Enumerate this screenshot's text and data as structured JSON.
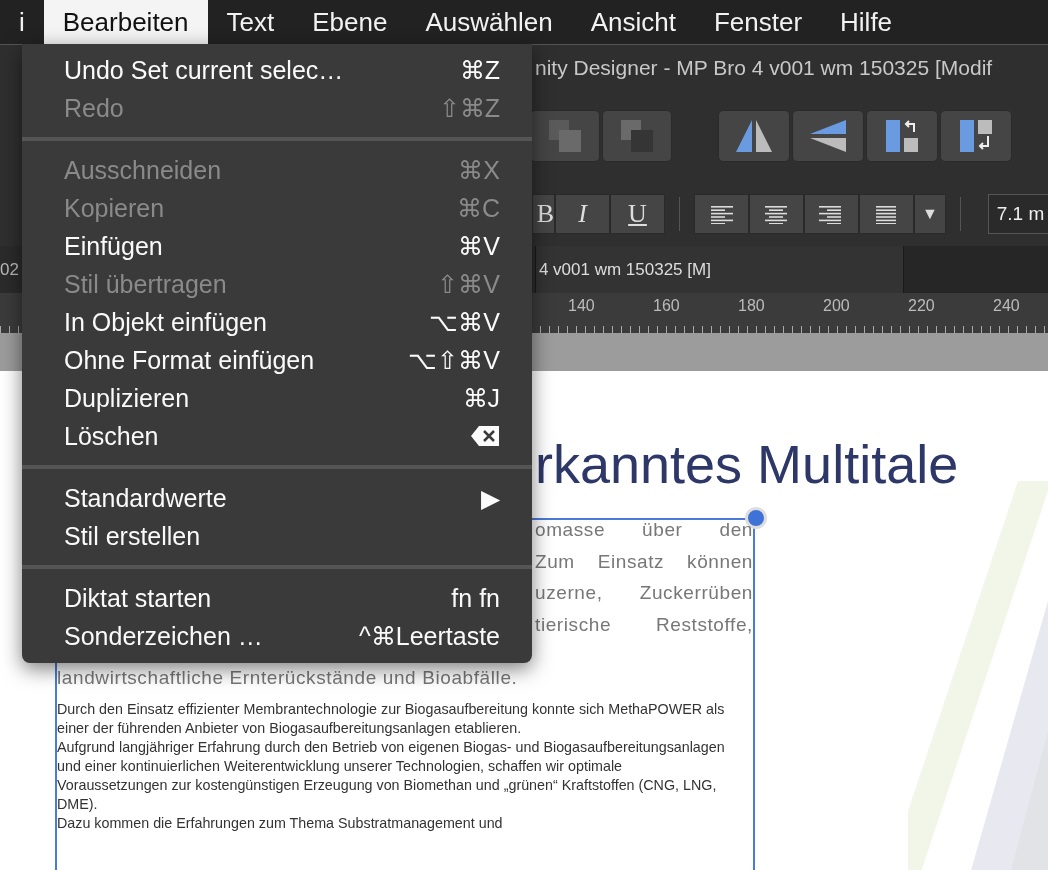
{
  "menubar": {
    "items": [
      {
        "label": "i",
        "selected": false
      },
      {
        "label": "Bearbeiten",
        "selected": true
      },
      {
        "label": "Text",
        "selected": false
      },
      {
        "label": "Ebene",
        "selected": false
      },
      {
        "label": "Auswählen",
        "selected": false
      },
      {
        "label": "Ansicht",
        "selected": false
      },
      {
        "label": "Fenster",
        "selected": false
      },
      {
        "label": "Hilfe",
        "selected": false
      }
    ]
  },
  "window": {
    "title": "nity Designer - MP Bro 4 v001 wm 150325 [Modif"
  },
  "text_toolbar": {
    "style_buttons": [
      "B",
      "I",
      "U"
    ],
    "align_dropdown": "▼",
    "font_size": "7.1 m"
  },
  "document_tabs": [
    {
      "label": "02",
      "selected": false
    },
    {
      "label": "4 v001 wm 150325 [M]",
      "selected": true
    }
  ],
  "ruler": {
    "labels": [
      "140",
      "160",
      "180",
      "200",
      "220",
      "240"
    ]
  },
  "edit_menu": {
    "groups": [
      {
        "items": [
          {
            "kind": "command",
            "label": "Undo Set current selec…",
            "shortcut": "⌘Z",
            "disabled": false
          },
          {
            "kind": "command",
            "label": "Redo",
            "shortcut": "⇧⌘Z",
            "disabled": true
          }
        ]
      },
      {
        "items": [
          {
            "kind": "command",
            "label": "Ausschneiden",
            "shortcut": "⌘X",
            "disabled": true
          },
          {
            "kind": "command",
            "label": "Kopieren",
            "shortcut": "⌘C",
            "disabled": true
          },
          {
            "kind": "command",
            "label": "Einfügen",
            "shortcut": "⌘V",
            "disabled": false
          },
          {
            "kind": "command",
            "label": "Stil übertragen",
            "shortcut": "⇧⌘V",
            "disabled": true
          },
          {
            "kind": "command",
            "label": "In Objekt einfügen",
            "shortcut": "⌥⌘V",
            "disabled": false
          },
          {
            "kind": "command",
            "label": "Ohne Format einfügen",
            "shortcut": "⌥⇧⌘V",
            "disabled": false
          },
          {
            "kind": "command",
            "label": "Duplizieren",
            "shortcut": "⌘J",
            "disabled": false
          },
          {
            "kind": "delete",
            "label": "Löschen",
            "disabled": false
          }
        ]
      },
      {
        "items": [
          {
            "kind": "command",
            "label": "Standardwerte",
            "shortcut": "▶",
            "disabled": false
          },
          {
            "kind": "command",
            "label": "Stil erstellen",
            "disabled": false
          }
        ]
      },
      {
        "items": [
          {
            "kind": "command",
            "label": "Diktat starten",
            "shortcut": "fn fn",
            "disabled": false
          },
          {
            "kind": "command",
            "label": "Sonderzeichen …",
            "shortcut": "^⌘Leertaste",
            "disabled": false
          }
        ]
      }
    ]
  },
  "document": {
    "heading": "rkanntes Multitale",
    "intro_lines": [
      "omasse über den",
      "Zum Einsatz können",
      "uzerne, Zuckerrüben",
      "tierische Reststoffe,"
    ],
    "intro_last_line": "landwirtschaftliche Ernterückstände und Bioabfälle.",
    "paragraphs": [
      "Durch den Einsatz effizienter Membrantechnologie zur Biogasaufbereitung konnte sich MethaPOWER als einer der führenden Anbieter von Biogasaufbereitungsanlagen etablieren.",
      "Aufgrund langjähriger Erfahrung durch den Betrieb von eigenen Biogas- und Biogasaufbereitungsanlagen und einer kontinuierlichen Weiterentwicklung unserer Technologien, schaffen wir optimale Voraussetzungen zur kostengünstigen Erzeugung von Biomethan und „grünen“ Kraftstoffen (CNG, LNG, DME).",
      "Dazu kommen die Erfahrungen zum Thema Substratmanagement und"
    ]
  }
}
